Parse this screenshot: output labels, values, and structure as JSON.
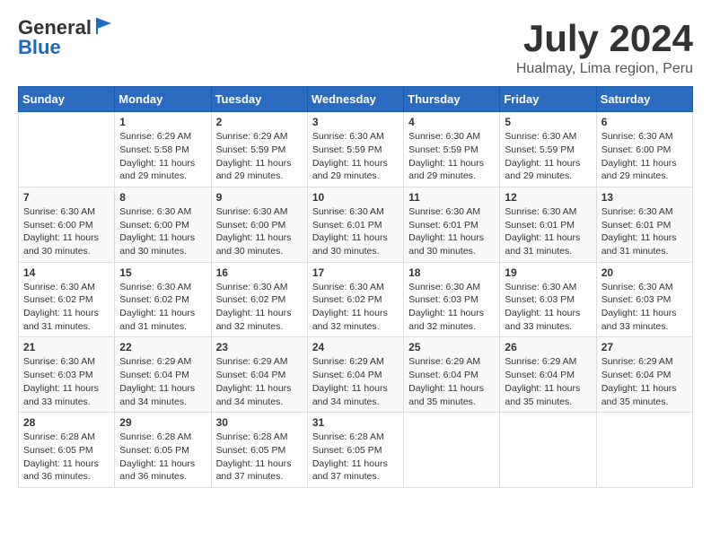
{
  "header": {
    "logo_general": "General",
    "logo_blue": "Blue",
    "month_title": "July 2024",
    "subtitle": "Hualmay, Lima region, Peru"
  },
  "calendar": {
    "days_of_week": [
      "Sunday",
      "Monday",
      "Tuesday",
      "Wednesday",
      "Thursday",
      "Friday",
      "Saturday"
    ],
    "weeks": [
      [
        {
          "day": "",
          "info": ""
        },
        {
          "day": "1",
          "info": "Sunrise: 6:29 AM\nSunset: 5:58 PM\nDaylight: 11 hours\nand 29 minutes."
        },
        {
          "day": "2",
          "info": "Sunrise: 6:29 AM\nSunset: 5:59 PM\nDaylight: 11 hours\nand 29 minutes."
        },
        {
          "day": "3",
          "info": "Sunrise: 6:30 AM\nSunset: 5:59 PM\nDaylight: 11 hours\nand 29 minutes."
        },
        {
          "day": "4",
          "info": "Sunrise: 6:30 AM\nSunset: 5:59 PM\nDaylight: 11 hours\nand 29 minutes."
        },
        {
          "day": "5",
          "info": "Sunrise: 6:30 AM\nSunset: 5:59 PM\nDaylight: 11 hours\nand 29 minutes."
        },
        {
          "day": "6",
          "info": "Sunrise: 6:30 AM\nSunset: 6:00 PM\nDaylight: 11 hours\nand 29 minutes."
        }
      ],
      [
        {
          "day": "7",
          "info": "Sunrise: 6:30 AM\nSunset: 6:00 PM\nDaylight: 11 hours\nand 30 minutes."
        },
        {
          "day": "8",
          "info": "Sunrise: 6:30 AM\nSunset: 6:00 PM\nDaylight: 11 hours\nand 30 minutes."
        },
        {
          "day": "9",
          "info": "Sunrise: 6:30 AM\nSunset: 6:00 PM\nDaylight: 11 hours\nand 30 minutes."
        },
        {
          "day": "10",
          "info": "Sunrise: 6:30 AM\nSunset: 6:01 PM\nDaylight: 11 hours\nand 30 minutes."
        },
        {
          "day": "11",
          "info": "Sunrise: 6:30 AM\nSunset: 6:01 PM\nDaylight: 11 hours\nand 30 minutes."
        },
        {
          "day": "12",
          "info": "Sunrise: 6:30 AM\nSunset: 6:01 PM\nDaylight: 11 hours\nand 31 minutes."
        },
        {
          "day": "13",
          "info": "Sunrise: 6:30 AM\nSunset: 6:01 PM\nDaylight: 11 hours\nand 31 minutes."
        }
      ],
      [
        {
          "day": "14",
          "info": "Sunrise: 6:30 AM\nSunset: 6:02 PM\nDaylight: 11 hours\nand 31 minutes."
        },
        {
          "day": "15",
          "info": "Sunrise: 6:30 AM\nSunset: 6:02 PM\nDaylight: 11 hours\nand 31 minutes."
        },
        {
          "day": "16",
          "info": "Sunrise: 6:30 AM\nSunset: 6:02 PM\nDaylight: 11 hours\nand 32 minutes."
        },
        {
          "day": "17",
          "info": "Sunrise: 6:30 AM\nSunset: 6:02 PM\nDaylight: 11 hours\nand 32 minutes."
        },
        {
          "day": "18",
          "info": "Sunrise: 6:30 AM\nSunset: 6:03 PM\nDaylight: 11 hours\nand 32 minutes."
        },
        {
          "day": "19",
          "info": "Sunrise: 6:30 AM\nSunset: 6:03 PM\nDaylight: 11 hours\nand 33 minutes."
        },
        {
          "day": "20",
          "info": "Sunrise: 6:30 AM\nSunset: 6:03 PM\nDaylight: 11 hours\nand 33 minutes."
        }
      ],
      [
        {
          "day": "21",
          "info": "Sunrise: 6:30 AM\nSunset: 6:03 PM\nDaylight: 11 hours\nand 33 minutes."
        },
        {
          "day": "22",
          "info": "Sunrise: 6:29 AM\nSunset: 6:04 PM\nDaylight: 11 hours\nand 34 minutes."
        },
        {
          "day": "23",
          "info": "Sunrise: 6:29 AM\nSunset: 6:04 PM\nDaylight: 11 hours\nand 34 minutes."
        },
        {
          "day": "24",
          "info": "Sunrise: 6:29 AM\nSunset: 6:04 PM\nDaylight: 11 hours\nand 34 minutes."
        },
        {
          "day": "25",
          "info": "Sunrise: 6:29 AM\nSunset: 6:04 PM\nDaylight: 11 hours\nand 35 minutes."
        },
        {
          "day": "26",
          "info": "Sunrise: 6:29 AM\nSunset: 6:04 PM\nDaylight: 11 hours\nand 35 minutes."
        },
        {
          "day": "27",
          "info": "Sunrise: 6:29 AM\nSunset: 6:04 PM\nDaylight: 11 hours\nand 35 minutes."
        }
      ],
      [
        {
          "day": "28",
          "info": "Sunrise: 6:28 AM\nSunset: 6:05 PM\nDaylight: 11 hours\nand 36 minutes."
        },
        {
          "day": "29",
          "info": "Sunrise: 6:28 AM\nSunset: 6:05 PM\nDaylight: 11 hours\nand 36 minutes."
        },
        {
          "day": "30",
          "info": "Sunrise: 6:28 AM\nSunset: 6:05 PM\nDaylight: 11 hours\nand 37 minutes."
        },
        {
          "day": "31",
          "info": "Sunrise: 6:28 AM\nSunset: 6:05 PM\nDaylight: 11 hours\nand 37 minutes."
        },
        {
          "day": "",
          "info": ""
        },
        {
          "day": "",
          "info": ""
        },
        {
          "day": "",
          "info": ""
        }
      ]
    ]
  }
}
